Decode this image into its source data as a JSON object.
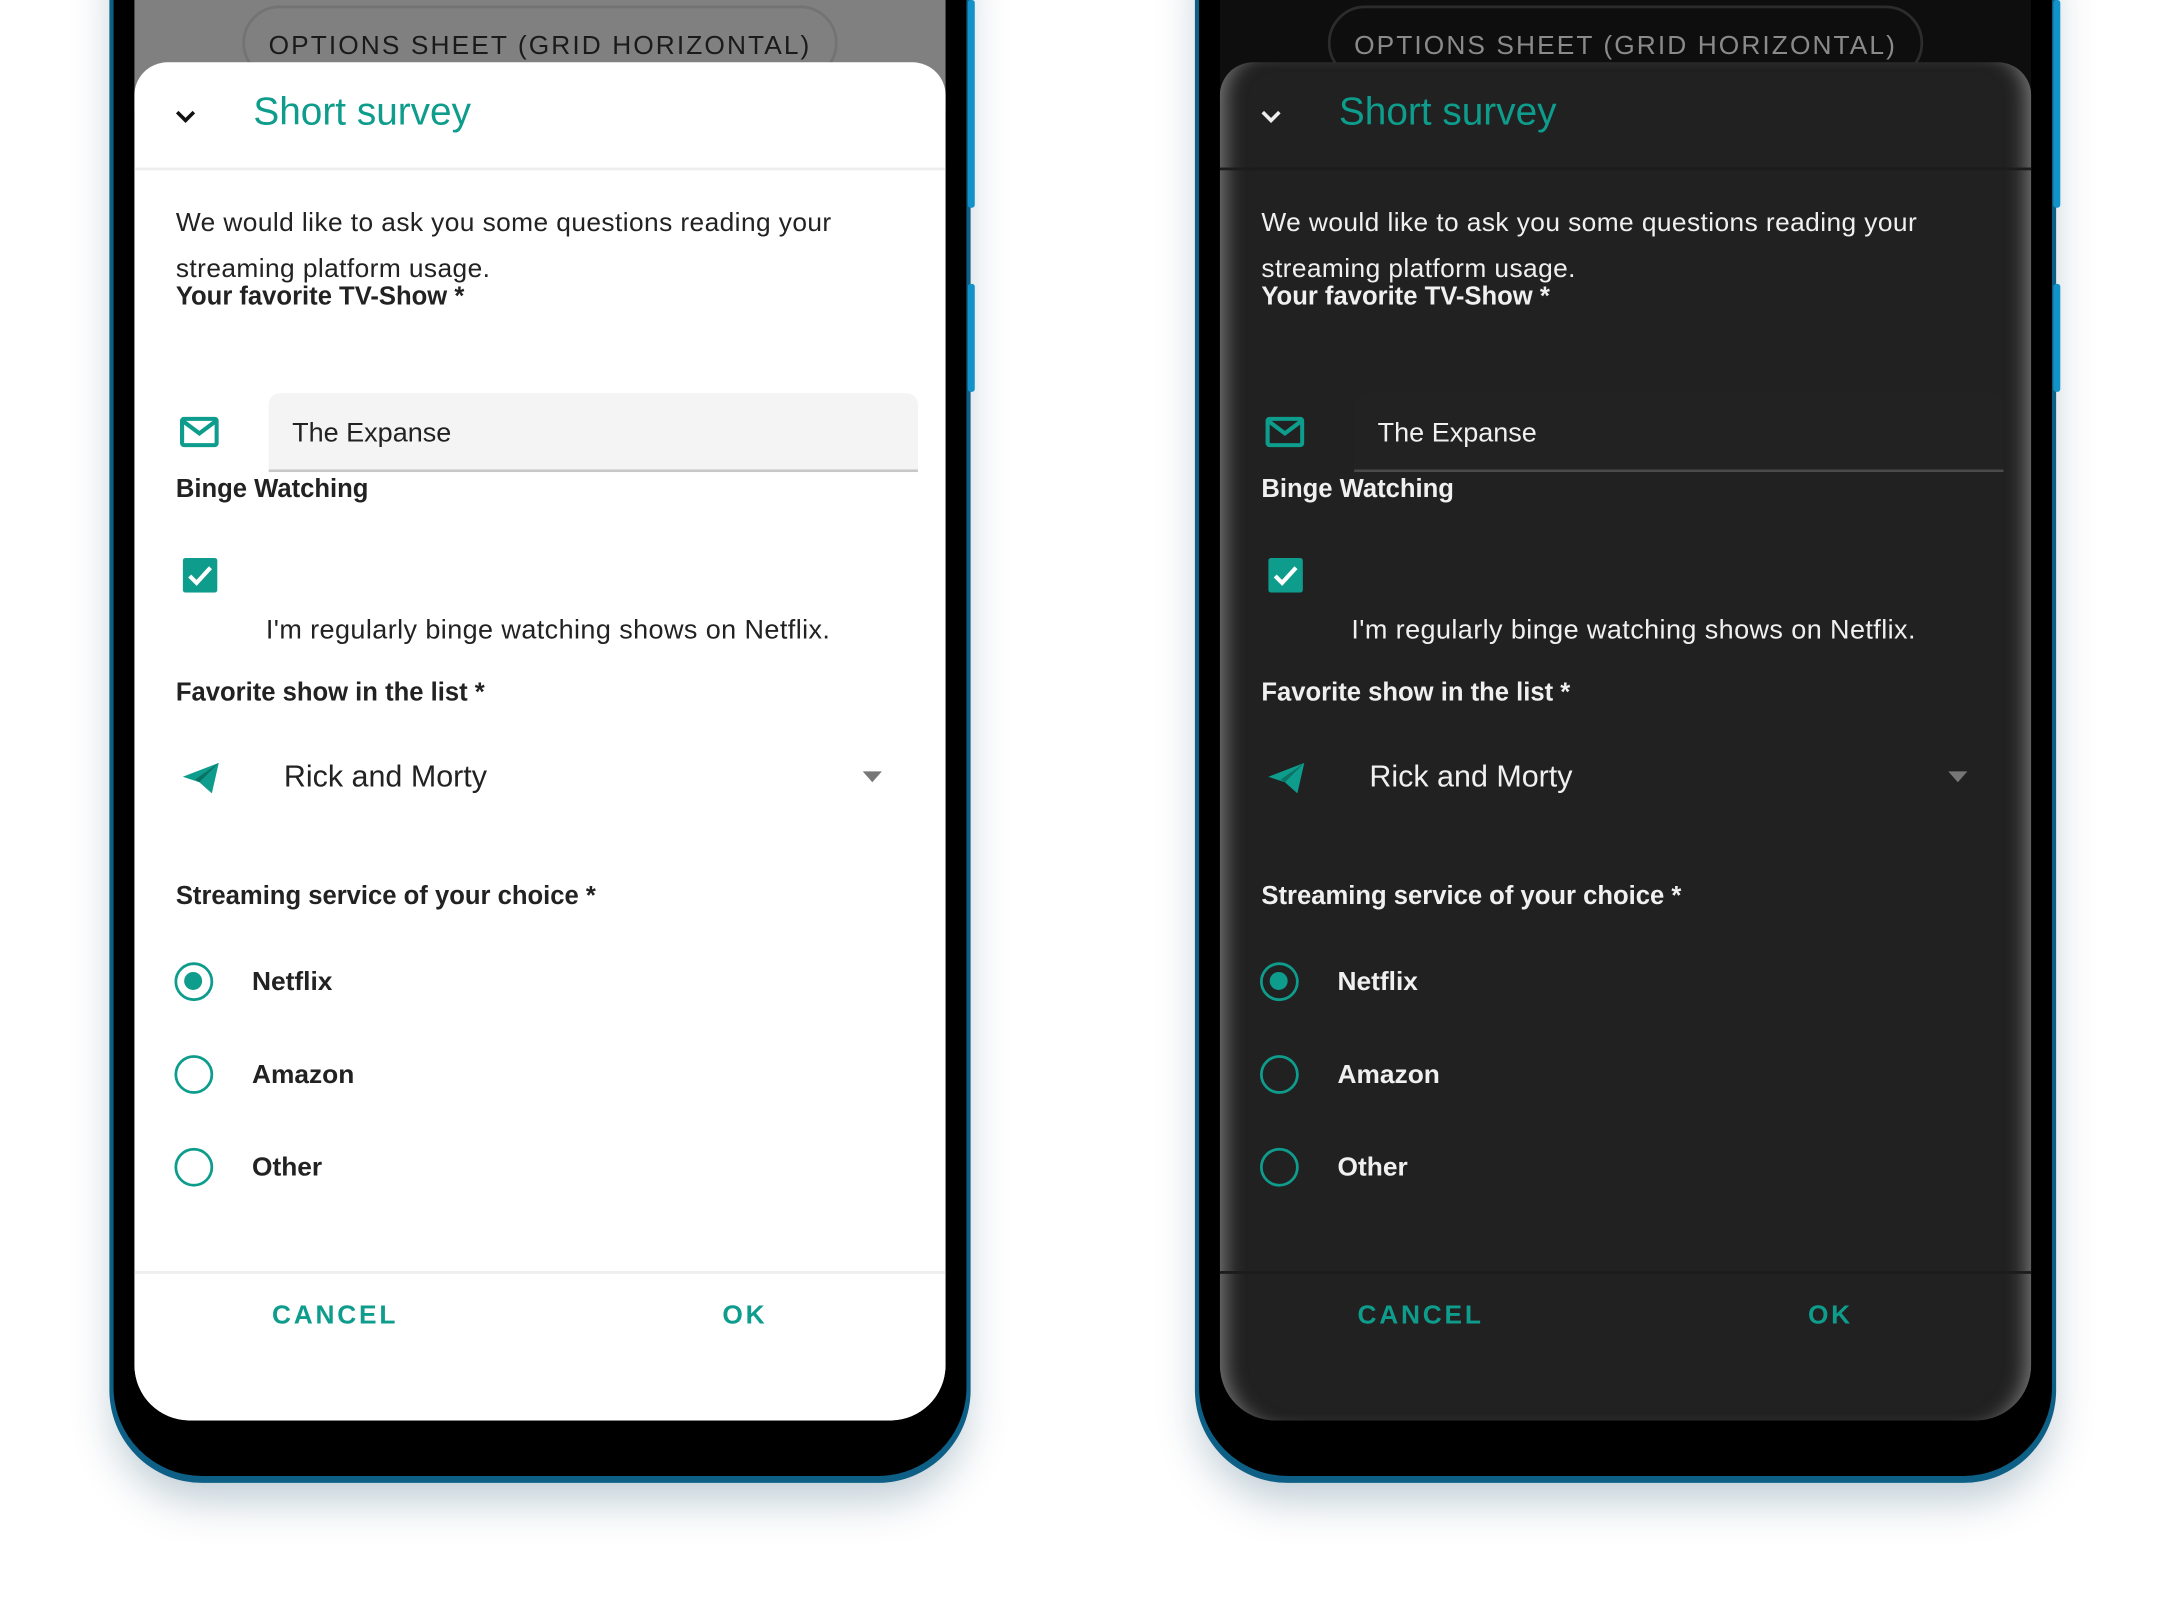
{
  "colors": {
    "accent": "#0e9c8c",
    "light_sheet": "#ffffff",
    "dark_sheet": "#212121"
  },
  "chip_label": "OPTIONS SHEET (GRID HORIZONTAL)",
  "survey": {
    "title": "Short survey",
    "description": "We would like to ask you some questions reading your streaming platform usage.",
    "tv_show": {
      "label": "Your favorite TV-Show *",
      "value": "The Expanse",
      "icon": "mail-icon"
    },
    "binge": {
      "label": "Binge Watching",
      "checkbox_label": "I'm regularly binge watching shows on Netflix.",
      "checked": true
    },
    "favorite": {
      "label": "Favorite show in the list *",
      "selected": "Rick and Morty",
      "icon": "send-icon"
    },
    "streaming": {
      "label": "Streaming service of your choice *",
      "options": [
        {
          "label": "Netflix",
          "selected": true
        },
        {
          "label": "Amazon",
          "selected": false
        },
        {
          "label": "Other",
          "selected": false
        }
      ]
    },
    "cancel": "CANCEL",
    "ok": "OK"
  },
  "themes": [
    "light",
    "dark"
  ]
}
